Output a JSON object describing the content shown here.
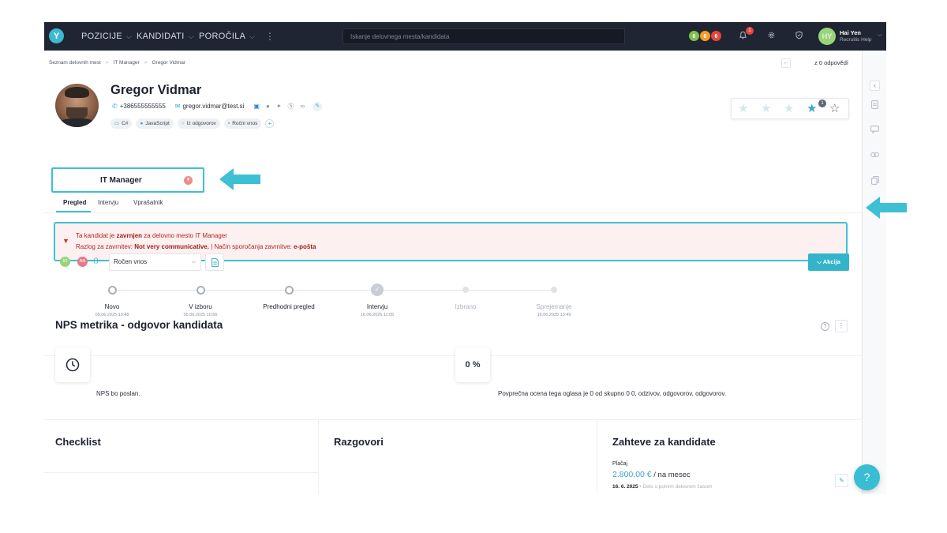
{
  "nav": {
    "logo": "Y",
    "items": [
      {
        "label": "POZICIJE"
      },
      {
        "label": "KANDIDATI"
      },
      {
        "label": "POROČILA"
      }
    ],
    "more": "⋮",
    "search_placeholder": "Iskanje delovnega mesta/kandidata",
    "pills": [
      {
        "value": "0",
        "color": "#7cc34e"
      },
      {
        "value": "0",
        "color": "#f39c2b"
      },
      {
        "value": "6",
        "color": "#e5473b"
      }
    ],
    "notifications_count": "1",
    "user_initials": "HY",
    "user_name": "Hai Yen",
    "user_org": "Recruitis Help"
  },
  "breadcrumb": {
    "items": [
      "Seznam delovnih mest",
      "IT Manager",
      "Gregor Vidmar"
    ],
    "counter": "z 0 odpovědí"
  },
  "candidate": {
    "name": "Gregor Vidmar",
    "phone": "+386555555555",
    "email": "gregor.vidmar@test.si",
    "tags": [
      {
        "icon": "monitor-icon",
        "label": "C#"
      },
      {
        "icon": "person-icon",
        "label": "JavaScript"
      },
      {
        "icon": "chat-icon",
        "label": "Iz odgovorov"
      },
      {
        "icon": "briefcase-icon",
        "label": "Ročni vnos"
      }
    ],
    "rating": 4,
    "rating_badge": "1"
  },
  "job_tab": {
    "label": "IT Manager"
  },
  "subtabs": [
    "Pregled",
    "Intervju",
    "Vprašalnik"
  ],
  "rejection": {
    "line1_pre": "Ta kandidat je ",
    "line1_bold": "zavrnjen",
    "line1_post": " za delovno mesto IT Manager",
    "line2_pre": "Razlog za zavrnitev: ",
    "line2_reason": "Not very communicative.",
    "line2_mid": " | Način sporočanja zavrnitve: ",
    "line2_channel": "e-pošta"
  },
  "toolbar": {
    "avatars": [
      {
        "initials": "IO",
        "color": "#9ad47a"
      },
      {
        "initials": "AN",
        "color": "#e57b8a"
      }
    ],
    "source_select": "Ročen vnos",
    "action_label": "Akcija"
  },
  "pipeline": [
    {
      "label": "Novo",
      "date": "05.06.2025 10:48",
      "state": "passed"
    },
    {
      "label": "V izboru",
      "date": "05.06.2025 10:56",
      "state": "passed"
    },
    {
      "label": "Predhodni pregled",
      "date": "",
      "state": "passed"
    },
    {
      "label": "Intervju",
      "date": "16.06.2025 11:05",
      "state": "current"
    },
    {
      "label": "Izbrano",
      "date": "",
      "state": "future"
    },
    {
      "label": "Sprejemanje",
      "date": "16.06.2025 10:49",
      "state": "future"
    }
  ],
  "nps": {
    "title": "NPS metrika - odgovor kandidata",
    "sent_text": "NPS bo poslan.",
    "percent": "0 %",
    "avg_text": "Povprečna ocena tega oglasa je 0 od skupno 0 0, odzivov, odgovorov, odgovorov."
  },
  "sections": {
    "checklist": "Checklist",
    "razgovori": "Razgovori",
    "zahteve": "Zahteve za kandidate",
    "pay_label": "Plačaj",
    "pay_amount": "2.800,00 €",
    "pay_unit": " / na mesec",
    "pay_date": "16. 6. 2025",
    "pay_type": "Delo s polnim delovnim časom"
  },
  "help": "?"
}
